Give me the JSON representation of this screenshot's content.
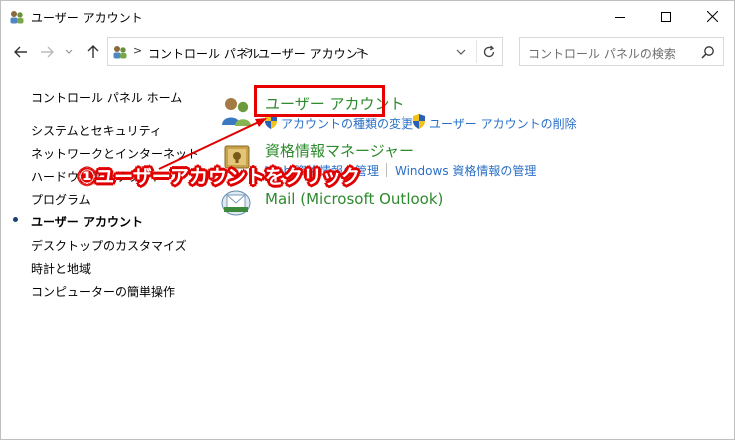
{
  "window": {
    "title": "ユーザー アカウント",
    "controls": {
      "minimize": "—",
      "maximize": "☐",
      "close": "✕"
    }
  },
  "address": {
    "crumbs": [
      "コントロール パネル",
      "ユーザー アカウント"
    ],
    "separator": ">"
  },
  "search": {
    "placeholder": "コントロール パネルの検索"
  },
  "sidebar": {
    "home": "コントロール パネル ホーム",
    "items": [
      {
        "label": "システムとセキュリティ"
      },
      {
        "label": "ネットワークとインターネット"
      },
      {
        "label": "ハードウェアとサウンド"
      },
      {
        "label": "プログラム"
      },
      {
        "label": "ユーザー アカウント",
        "active": true
      },
      {
        "label": "デスクトップのカスタマイズ"
      },
      {
        "label": "時計と地域"
      },
      {
        "label": "コンピューターの簡単操作"
      }
    ]
  },
  "categories": [
    {
      "title": "ユーザー アカウント",
      "links": [
        "アカウントの種類の変更",
        "ユーザー アカウントの削除"
      ]
    },
    {
      "title": "資格情報マネージャー",
      "links": [
        "Web 資格情報の管理",
        "Windows 資格情報の管理"
      ]
    },
    {
      "title": "Mail (Microsoft Outlook)",
      "links": []
    }
  ],
  "annotation": {
    "text": "①ユーザーアカウントをクリック",
    "color": "#e00000"
  },
  "colors": {
    "link": "#2a6fc7",
    "category_title": "#2d8a2d",
    "highlight": "#e60000"
  }
}
